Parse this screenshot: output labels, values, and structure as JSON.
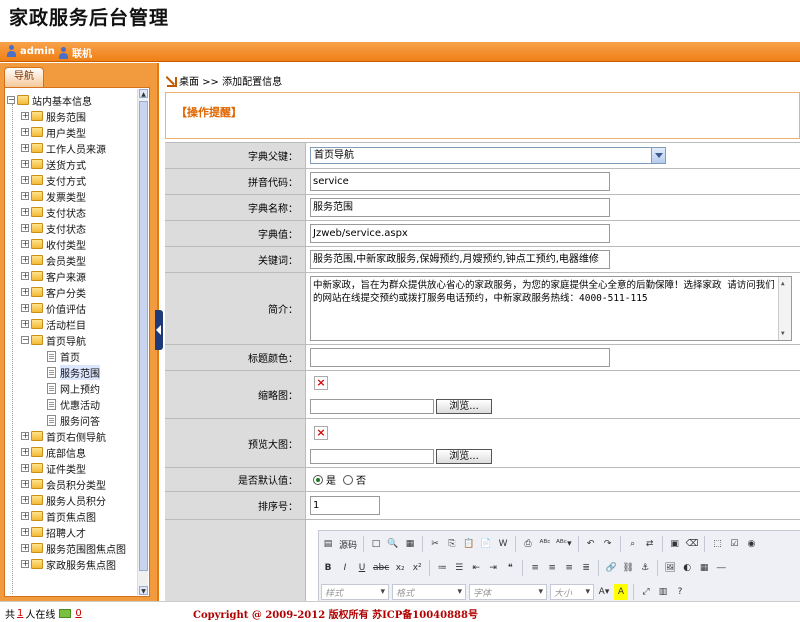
{
  "app": {
    "title": "家政服务后台管理"
  },
  "userbar": {
    "user": "admin",
    "status": "联机"
  },
  "nav": {
    "tab_label": "导航",
    "root": "站内基本信息",
    "items": [
      "服务范围",
      "用户类型",
      "工作人员来源",
      "送货方式",
      "支付方式",
      "发票类型",
      "支付状态",
      "支付状态",
      "收付类型",
      "会员类型",
      "客户来源",
      "客户分类",
      "价值评估",
      "活动栏目",
      "首页导航"
    ],
    "subitems": [
      "首页",
      "服务范围",
      "网上预约",
      "优惠活动",
      "服务问答"
    ],
    "items2": [
      "首页右侧导航",
      "底部信息",
      "证件类型",
      "会员积分类型",
      "服务人员积分",
      "首页焦点图",
      "招聘人才",
      "服务范围图焦点图",
      "家政服务焦点图"
    ]
  },
  "main": {
    "breadcrumb": "桌面 >> 添加配置信息",
    "notice_label": "【操作提醒】",
    "fields": {
      "parent_label": "字典父键：",
      "parent_value": "首页导航",
      "pinyin_label": "拼音代码：",
      "pinyin_value": "service",
      "name_label": "字典名称：",
      "name_value": "服务范围",
      "value_label": "字典值：",
      "value_value": "Jzweb/service.aspx",
      "keywords_label": "关键词：",
      "keywords_value": "服务范围,中新家政服务,保姆预约,月嫂预约,钟点工预约,电器维修",
      "intro_label": "简介：",
      "intro_value": "中新家政，旨在为群众提供放心省心的家政服务，为您的家庭提供全心全意的后勤保障！选择家政 请访问我们的网站在线提交预约或拨打服务电话预约，中新家政服务热线：4000-511-115",
      "title_color_label": "标题颜色：",
      "title_color_value": "",
      "thumb_label": "缩略图：",
      "preview_label": "预览大图：",
      "browse_label": "浏览...",
      "default_label": "是否默认值：",
      "yes_label": "是",
      "no_label": "否",
      "sort_label": "排序号：",
      "sort_value": "1"
    },
    "editor": {
      "source_label": "源码",
      "style_placeholder": "样式",
      "format_placeholder": "格式",
      "font_placeholder": "字体",
      "size_placeholder": "大小"
    }
  },
  "footer": {
    "online_prefix": "共",
    "online_count": "1",
    "online_suffix": "人在线",
    "mail_count": "0",
    "copyright": "Copyright @ 2009-2012 版权所有  苏ICP备10040888号"
  },
  "colors": {
    "orange": "#ef7f16",
    "label_bg": "#dcdcdc",
    "copyright": "#b00000",
    "notice": "#e06600"
  }
}
